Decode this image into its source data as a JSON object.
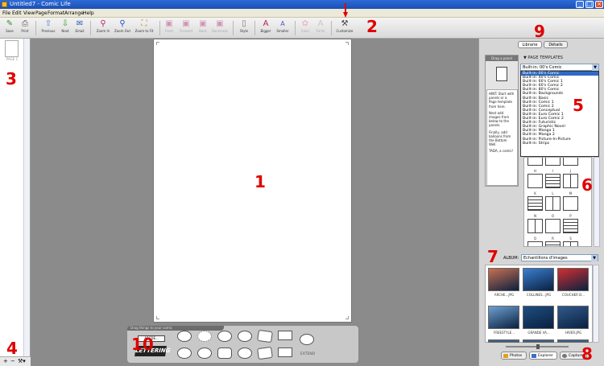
{
  "window": {
    "title": "Untitled7 - Comic Life"
  },
  "menu": [
    "File",
    "Edit",
    "View",
    "Page",
    "Format",
    "Arrange",
    "Help"
  ],
  "toolbar": [
    {
      "label": "Save",
      "icon": "save-icon",
      "enabled": true
    },
    {
      "label": "Print",
      "icon": "print-icon",
      "enabled": true
    },
    {
      "label": "Previous",
      "icon": "previous-icon",
      "enabled": true
    },
    {
      "label": "Next",
      "icon": "next-icon",
      "enabled": true
    },
    {
      "label": "Email",
      "icon": "email-icon",
      "enabled": true
    },
    {
      "label": "Zoom In",
      "icon": "zoom-in-icon",
      "enabled": true
    },
    {
      "label": "Zoom Out",
      "icon": "zoom-out-icon",
      "enabled": true
    },
    {
      "label": "Zoom to Fit",
      "icon": "zoom-fit-icon",
      "enabled": true
    },
    {
      "label": "Front",
      "icon": "front-icon",
      "enabled": false
    },
    {
      "label": "Forward",
      "icon": "forward-icon",
      "enabled": false
    },
    {
      "label": "Back",
      "icon": "back-icon",
      "enabled": false
    },
    {
      "label": "Backmost",
      "icon": "backmost-icon",
      "enabled": false
    },
    {
      "label": "Style",
      "icon": "style-icon",
      "enabled": true
    },
    {
      "label": "Bigger",
      "icon": "bigger-icon",
      "enabled": true
    },
    {
      "label": "Smaller",
      "icon": "smaller-icon",
      "enabled": true
    },
    {
      "label": "Color",
      "icon": "color-icon",
      "enabled": false
    },
    {
      "label": "Fonts",
      "icon": "fonts-icon",
      "enabled": false
    },
    {
      "label": "Customize",
      "icon": "customize-icon",
      "enabled": true
    }
  ],
  "left_panel": {
    "page_label": "PAGE 1",
    "controls": [
      "+",
      "−",
      "⚒▾"
    ]
  },
  "right_panel": {
    "tabs": [
      "Librarie",
      "Détails"
    ],
    "drag_panel": {
      "header": "Drag a panel",
      "hint": [
        "HINT: Start with panels or a Page template from here.",
        "Next add images from below to the panels.",
        "Finally, add balloons from the Bottom Well.",
        "TADA, a comic!"
      ]
    },
    "page_templates": {
      "label": "▼ PAGE TEMPLATES",
      "selected": "Built-in: 00's Comic",
      "options": [
        "Built-in: 00's Comic",
        "Built-in: 40's Comic",
        "Built-in: 60's Comic 1",
        "Built-in: 60's Comic 2",
        "Built-in: 80's Comic",
        "Built-in: Backgrounds",
        "Built-in: Basic",
        "Built-in: Comic 1",
        "Built-in: Comic 2",
        "Built-in: Conceptual",
        "Built-in: Euro Comic 1",
        "Built-in: Euro Comic 2",
        "Built-in: Futuristic",
        "Built-in: Graphic Novel",
        "Built-in: Manga 1",
        "Built-in: Manga 2",
        "Built-in: Picture-In-Picture",
        "Built-in: Strips"
      ],
      "grid_labels": [
        "H",
        "I",
        "J",
        "K",
        "L",
        "M",
        "N",
        "O",
        "P",
        "Q",
        "R",
        "S"
      ]
    },
    "album": {
      "label": "ALBUM:",
      "selected": "Echantillons d'images",
      "images": [
        {
          "label": "ARCHE...JPG",
          "color": "#c87050"
        },
        {
          "label": "COLLINES...JPG",
          "color": "#3a7fd0"
        },
        {
          "label": "COUCHER D...",
          "color": "#d03030"
        },
        {
          "label": "FREESTYLE...",
          "color": "#6fa0d0"
        },
        {
          "label": "GRANDE VA...",
          "color": "#1e4e80"
        },
        {
          "label": "HIVER.JPG",
          "color": "#305a8a"
        }
      ]
    },
    "sources": [
      "Photos",
      "Explorer",
      "Capture"
    ]
  },
  "palette": {
    "header": "Drag things to your comic",
    "lettering_text": "LETTERING",
    "caption_text": "ABCDE...",
    "extend_label": "EXTEND"
  },
  "annotations": [
    "1",
    "2",
    "3",
    "4",
    "5",
    "6",
    "7",
    "8",
    "9",
    "10"
  ]
}
